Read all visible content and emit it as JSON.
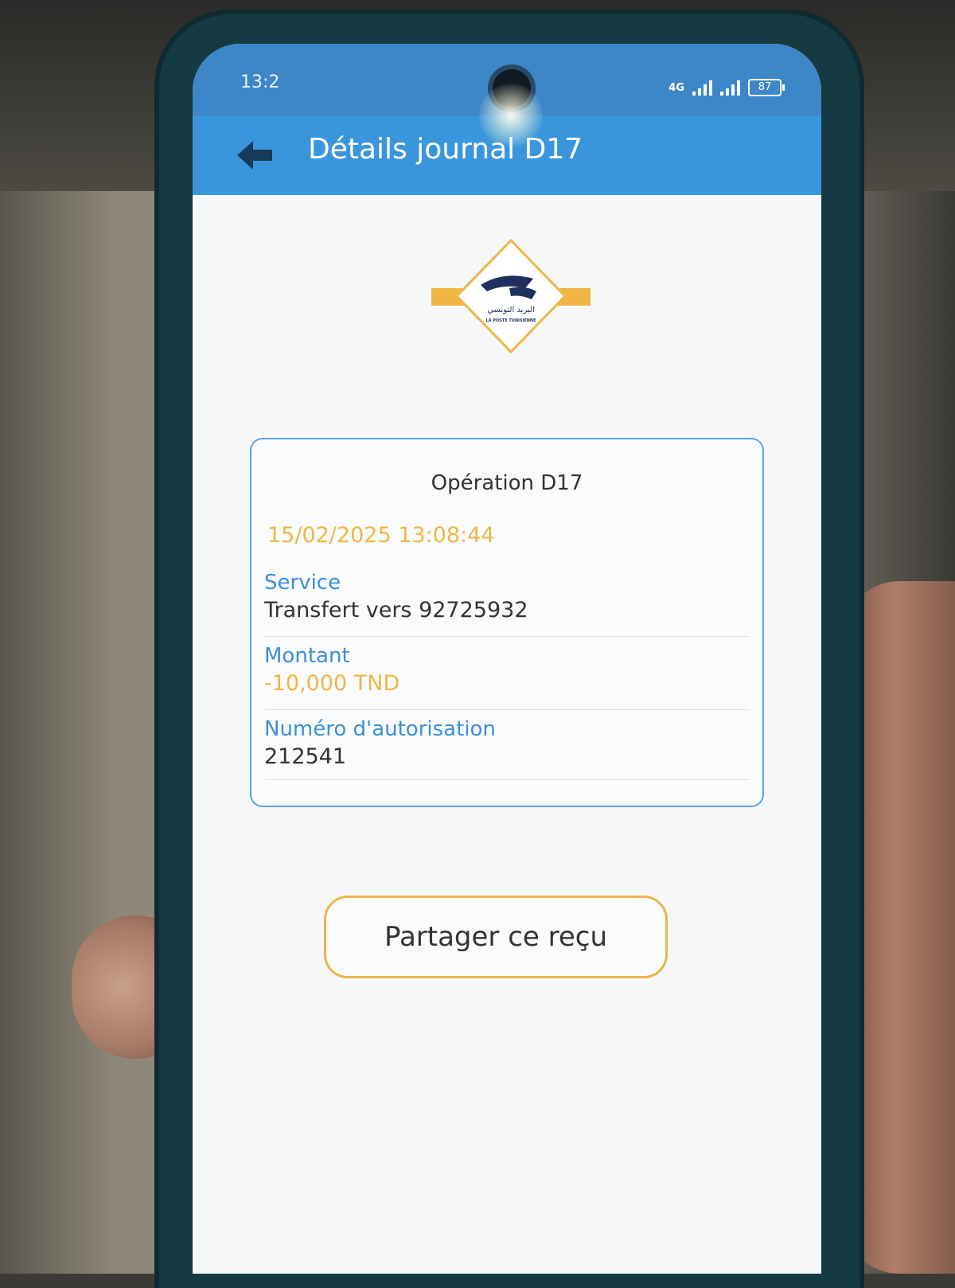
{
  "status_bar": {
    "time": "13:2",
    "network": "4G",
    "battery": "87"
  },
  "app_bar": {
    "title": "Détails journal D17",
    "back_icon": "arrow-left-icon"
  },
  "logo": {
    "name": "la-poste-tunisienne-logo",
    "arabic_text": "البريد التونسي",
    "latin_text": "LA POSTE TUNISIENNE"
  },
  "receipt": {
    "title": "Opération D17",
    "datetime": "15/02/2025 13:08:44",
    "fields": [
      {
        "label": "Service",
        "value": "Transfert vers 92725932"
      },
      {
        "label": "Montant",
        "value": "-10,000 TND"
      },
      {
        "label": "Numéro d'autorisation",
        "value": "212541"
      }
    ]
  },
  "actions": {
    "share_label": "Partager ce reçu"
  },
  "colors": {
    "app_bar": "#3a96dc",
    "label_blue": "#3a8fd8",
    "accent_yellow": "#f0b545",
    "card_border": "#5aa6e6"
  }
}
